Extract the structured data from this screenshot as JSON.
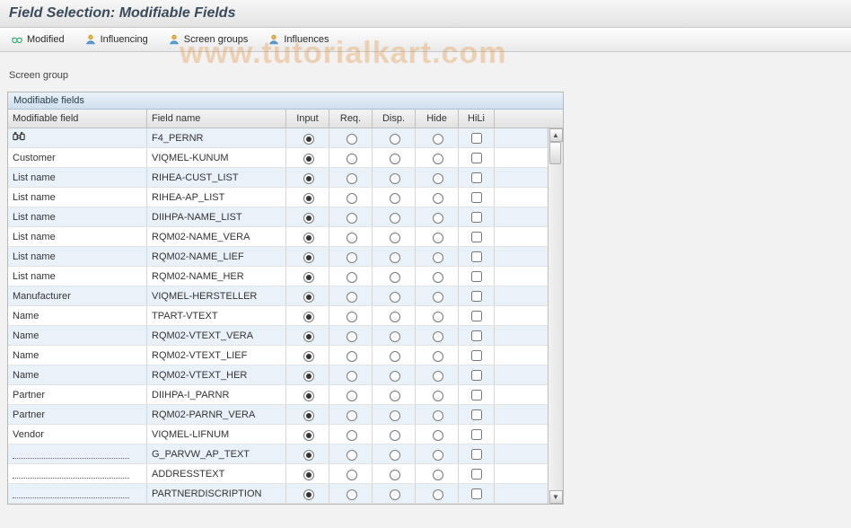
{
  "header": {
    "title": "Field Selection: Modifiable Fields"
  },
  "toolbar": {
    "modified": "Modified",
    "influencing": "Influencing",
    "screen_groups": "Screen groups",
    "influences": "Influences"
  },
  "labels": {
    "screen_group": "Screen group"
  },
  "table": {
    "title": "Modifiable fields",
    "columns": {
      "modifiable": "Modifiable field",
      "field_name": "Field name",
      "input": "Input",
      "req": "Req.",
      "disp": "Disp.",
      "hide": "Hide",
      "hili": "HiLi"
    },
    "rows": [
      {
        "mod_label": "",
        "mod_icon": "binoculars",
        "field": "F4_PERNR",
        "sel": "input",
        "hili": false
      },
      {
        "mod_label": "Customer",
        "field": "VIQMEL-KUNUM",
        "sel": "input",
        "hili": false
      },
      {
        "mod_label": "List name",
        "field": "RIHEA-CUST_LIST",
        "sel": "input",
        "hili": false
      },
      {
        "mod_label": "List name",
        "field": "RIHEA-AP_LIST",
        "sel": "input",
        "hili": false
      },
      {
        "mod_label": "List name",
        "field": "DIIHPA-NAME_LIST",
        "sel": "input",
        "hili": false
      },
      {
        "mod_label": "List name",
        "field": "RQM02-NAME_VERA",
        "sel": "input",
        "hili": false
      },
      {
        "mod_label": "List name",
        "field": "RQM02-NAME_LIEF",
        "sel": "input",
        "hili": false
      },
      {
        "mod_label": "List name",
        "field": "RQM02-NAME_HER",
        "sel": "input",
        "hili": false
      },
      {
        "mod_label": "Manufacturer",
        "field": "VIQMEL-HERSTELLER",
        "sel": "input",
        "hili": false
      },
      {
        "mod_label": "Name",
        "field": "TPART-VTEXT",
        "sel": "input",
        "hili": false
      },
      {
        "mod_label": "Name",
        "field": "RQM02-VTEXT_VERA",
        "sel": "input",
        "hili": false
      },
      {
        "mod_label": "Name",
        "field": "RQM02-VTEXT_LIEF",
        "sel": "input",
        "hili": false
      },
      {
        "mod_label": "Name",
        "field": "RQM02-VTEXT_HER",
        "sel": "input",
        "hili": false
      },
      {
        "mod_label": "Partner",
        "field": "DIIHPA-I_PARNR",
        "sel": "input",
        "hili": false
      },
      {
        "mod_label": "Partner",
        "field": "RQM02-PARNR_VERA",
        "sel": "input",
        "hili": false
      },
      {
        "mod_label": "Vendor",
        "field": "VIQMEL-LIFNUM",
        "sel": "input",
        "hili": false
      },
      {
        "mod_label": "",
        "mod_dotted": true,
        "field": "G_PARVW_AP_TEXT",
        "sel": "input",
        "hili": false
      },
      {
        "mod_label": "",
        "mod_dotted": true,
        "field": "ADDRESSTEXT",
        "sel": "input",
        "hili": false
      },
      {
        "mod_label": "",
        "mod_dotted": true,
        "field": "PARTNERDISCRIPTION",
        "sel": "input",
        "hili": false
      }
    ]
  },
  "watermark": "www.tutorialkart.com"
}
